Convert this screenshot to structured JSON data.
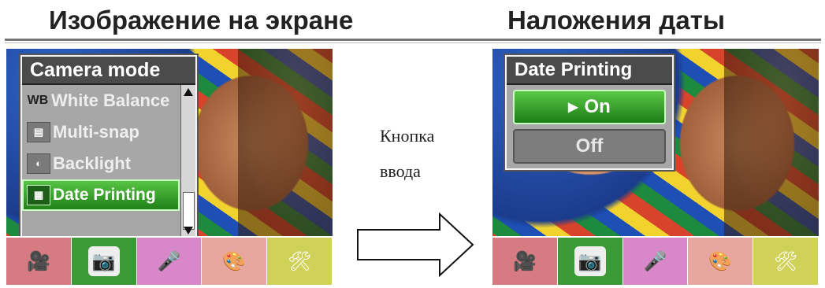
{
  "headings": {
    "left": "Изображение на экране",
    "right": "Наложения даты"
  },
  "middle": {
    "line1": "Кнопка",
    "line2": "ввода"
  },
  "left_screen": {
    "menu_title": "Camera mode",
    "items": [
      {
        "icon": "WB",
        "label": "White Balance",
        "selected": false
      },
      {
        "icon": "multi-snap-icon",
        "label": "Multi-snap",
        "selected": false
      },
      {
        "icon": "backlight-icon",
        "label": "Backlight",
        "selected": false
      },
      {
        "icon": "date-icon",
        "label": "Date Printing",
        "selected": true
      }
    ]
  },
  "right_screen": {
    "menu_title": "Date Printing",
    "options": [
      {
        "label": "On",
        "selected": true
      },
      {
        "label": "Off",
        "selected": false
      }
    ]
  },
  "mode_tabs": [
    "video-camera-icon",
    "camera-icon",
    "microphone-icon",
    "palette-icon",
    "tools-icon"
  ],
  "colors": {
    "selected_green": "#3b9a36",
    "menu_gray": "#a7a7a7"
  }
}
